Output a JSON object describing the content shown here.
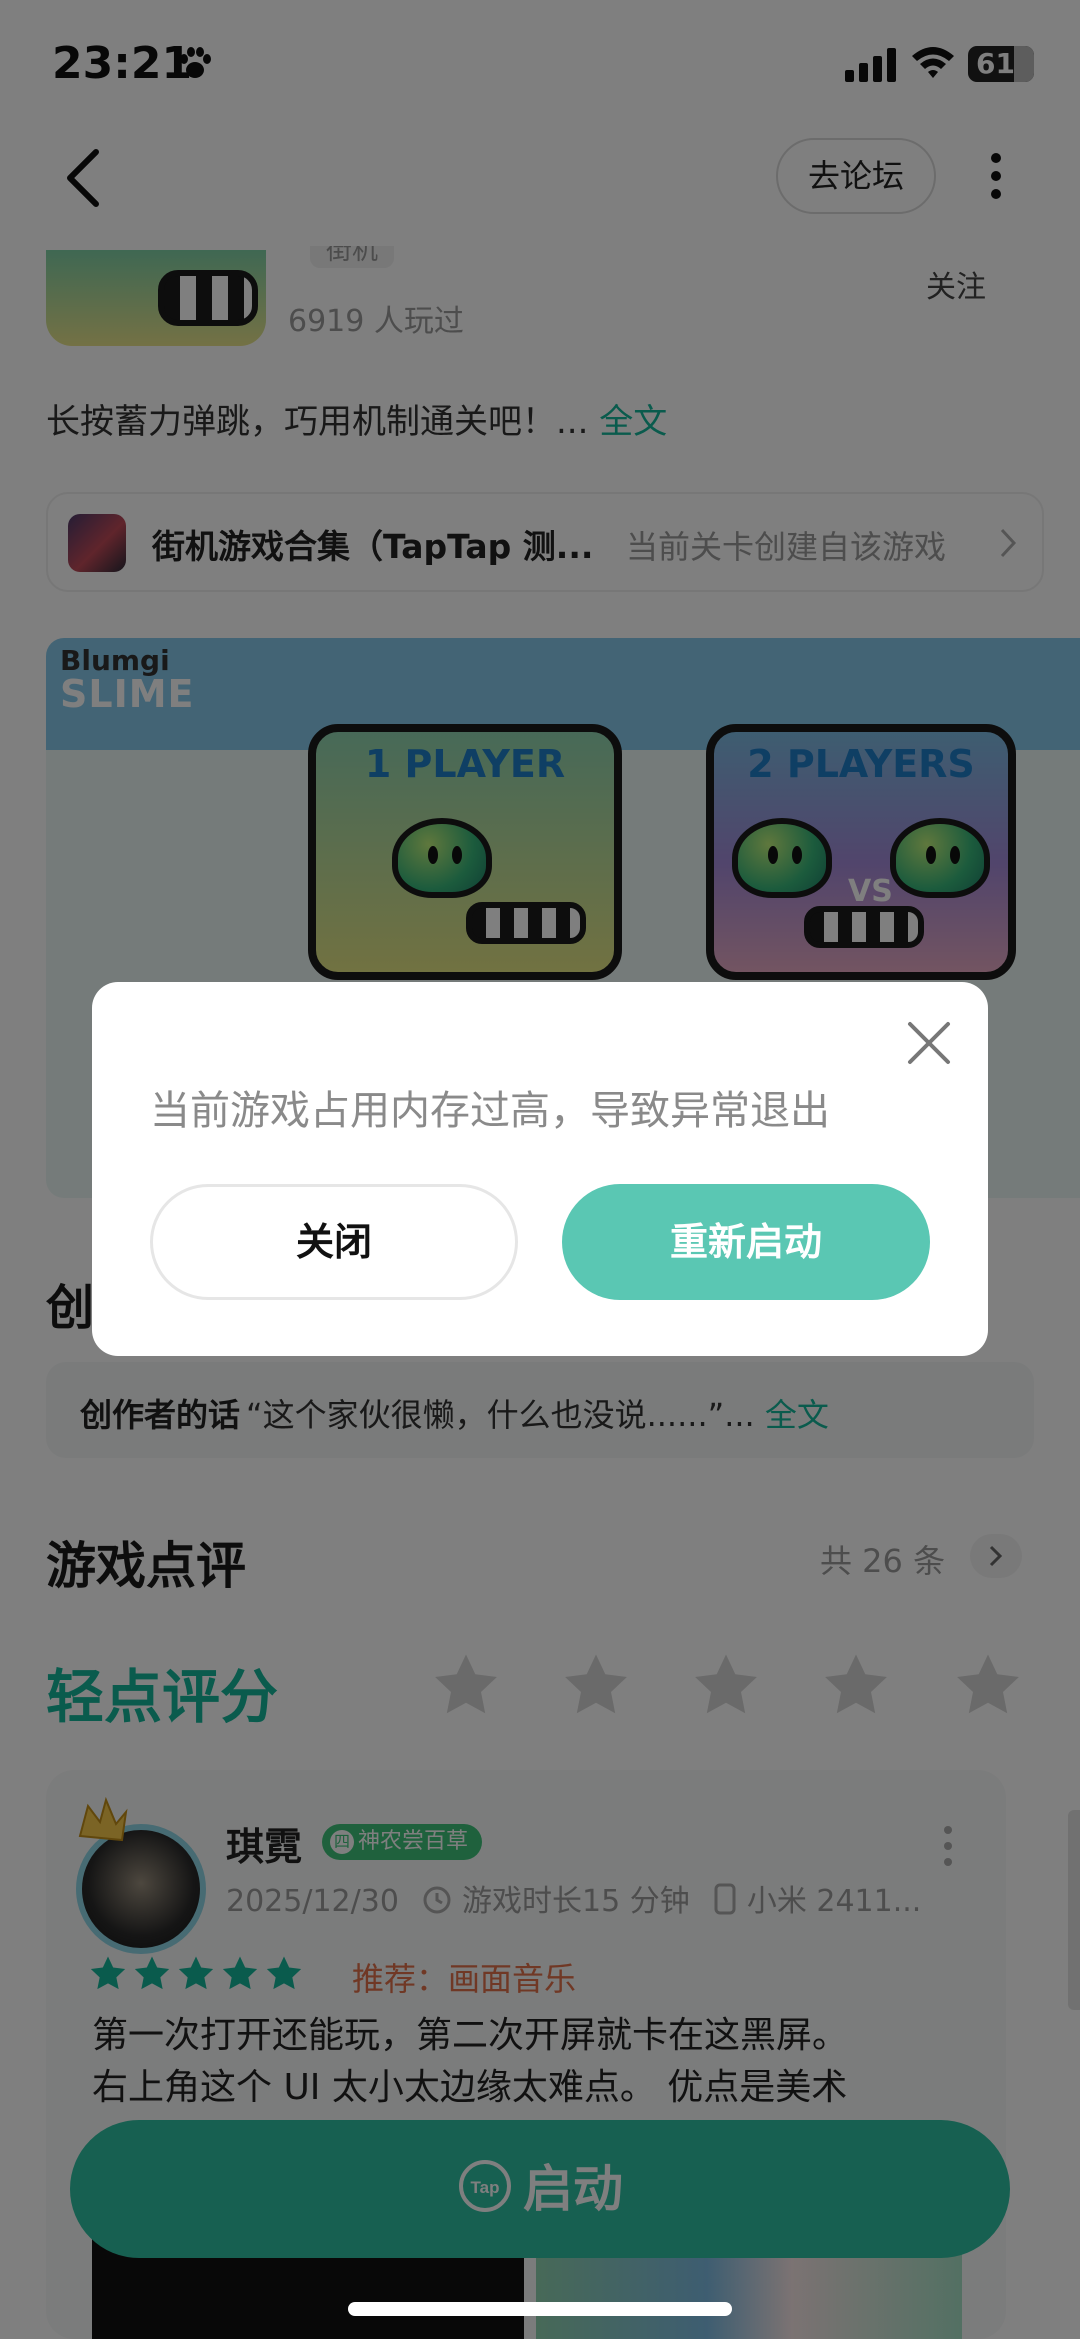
{
  "status_bar": {
    "time": "23:21",
    "battery": "61"
  },
  "header": {
    "forum_label": "去论坛"
  },
  "game": {
    "tag": "街机",
    "played": "6919 人玩过",
    "follow_label": "关注",
    "description": "长按蓄力弹跳，巧用机制通关吧！... ",
    "description_more": "全文",
    "collection_name": "街机游戏合集（TapTap 测...",
    "collection_note": "当前关卡创建自该游戏"
  },
  "preview": {
    "logo": "Blumgi",
    "title": "SLIME",
    "card1_label": "1 PLAYER",
    "card2_label": "2 PLAYERS",
    "vs": "VS"
  },
  "creator": {
    "heading": "创",
    "label": "创作者的话",
    "text": "“这个家伙很懒，什么也没说......”... ",
    "more": "全文"
  },
  "reviews": {
    "heading": "游戏点评",
    "count": "共 26 条",
    "tap_rate": "轻点评分",
    "rating_stars": 5
  },
  "review": {
    "name": "琪霓",
    "badge_icon": "四",
    "badge": "神农尝百草",
    "date": "2025/12/30",
    "playtime": "游戏时长15 分钟",
    "device": "小米 2411...",
    "stars": 5,
    "recommend": "推荐：画面音乐",
    "line1": "第一次打开还能玩，第二次开屏就卡在这黑屏。",
    "line2": "右上角这个 UI 太小太边缘太难点。 优点是美术"
  },
  "launch": {
    "label": "启动",
    "icon_text": "Tap"
  },
  "dialog": {
    "message": "当前游戏占用内存过高，导致异常退出",
    "close_label": "关闭",
    "restart_label": "重新启动"
  },
  "colors": {
    "accent": "#15b79a",
    "restart": "#5ac7b3",
    "launch": "#2ec0a2",
    "recommend": "#e0704a"
  }
}
